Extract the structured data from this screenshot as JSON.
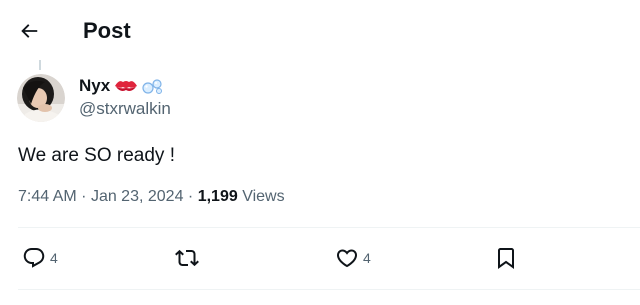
{
  "header": {
    "title": "Post",
    "back_icon": "arrow-left-icon"
  },
  "author": {
    "display_name": "Nyx",
    "handle": "@stxrwalkin",
    "emojis": [
      "kiss-mark-emoji",
      "bubbles-emoji"
    ]
  },
  "tweet": {
    "text": "We are SO ready !"
  },
  "meta": {
    "time": "7:44 AM",
    "separator": "·",
    "date": "Jan 23, 2024",
    "views_count": "1,199",
    "views_label": "Views"
  },
  "actions": {
    "reply_count": "4",
    "like_count": "4"
  },
  "colors": {
    "text": "#0f1419",
    "secondary": "#536471",
    "divider": "#eff3f4"
  }
}
